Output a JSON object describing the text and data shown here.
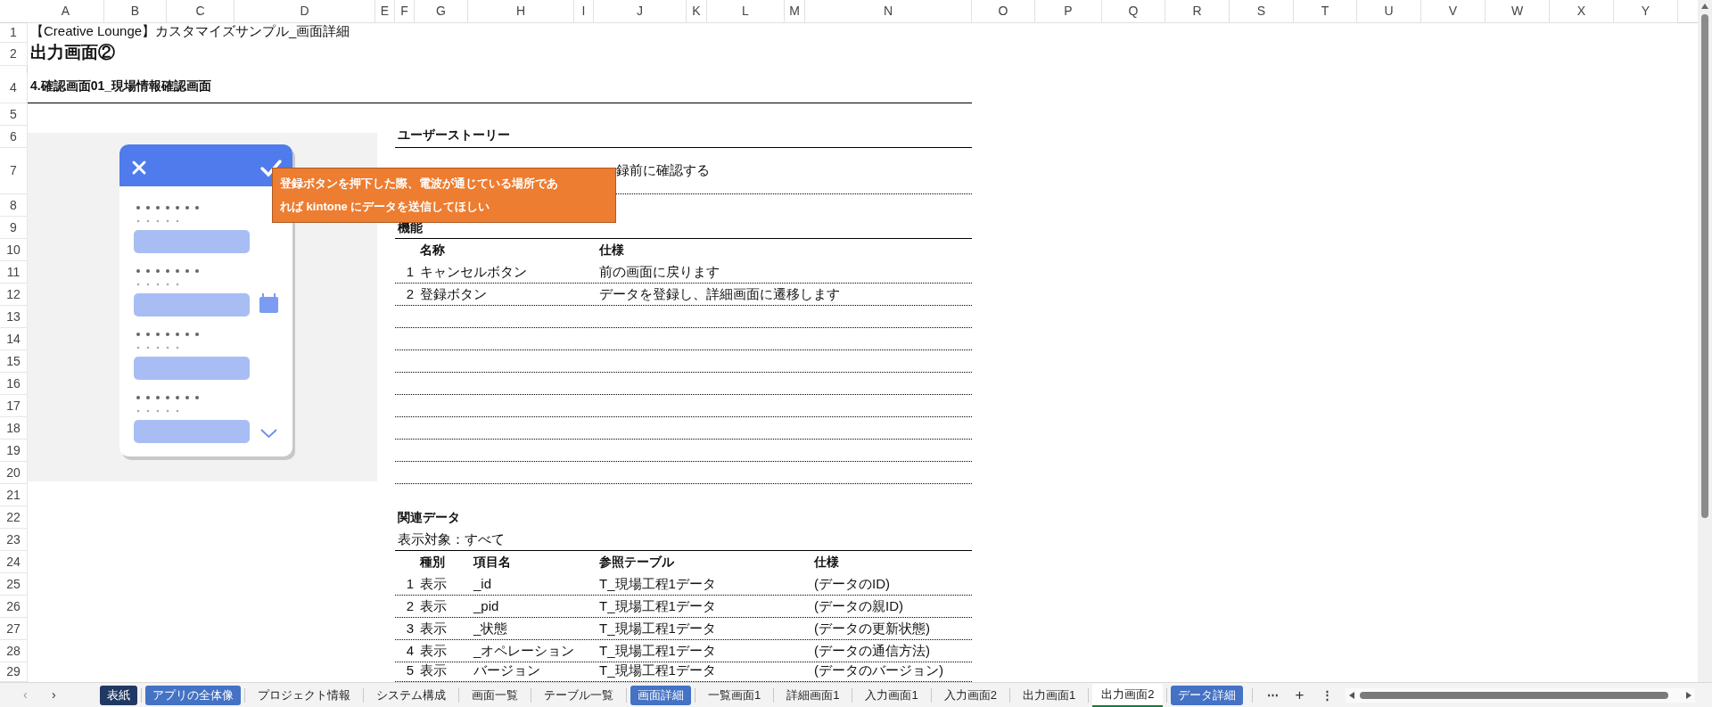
{
  "sheet": {
    "column_headers": [
      "A",
      "B",
      "C",
      "D",
      "E",
      "F",
      "G",
      "H",
      "I",
      "J",
      "K",
      "L",
      "M",
      "N",
      "O",
      "P",
      "Q",
      "R",
      "S",
      "T",
      "U",
      "V",
      "W",
      "X",
      "Y"
    ],
    "row_headers": [
      "1",
      "2",
      "4",
      "5",
      "6",
      "7",
      "8",
      "9",
      "10",
      "11",
      "12",
      "13",
      "14",
      "15",
      "16",
      "17",
      "18",
      "19",
      "20",
      "21",
      "22",
      "23",
      "24",
      "25",
      "26",
      "27",
      "28",
      "29"
    ],
    "title": "【Creative Lounge】カスタマイズサンプル_画面詳細",
    "heading": "出力画面②",
    "section": "4.確認画面01_現場情報確認画面",
    "user_story": {
      "heading": "ユーザーストーリー",
      "text": "録前に確認する"
    },
    "comment": {
      "lines": [
        "登録ボタンを押下した際、電波が通じている場所であ",
        "れば kintone にデータを送信してほしい"
      ]
    },
    "features": {
      "heading": "機能",
      "columns": [
        "名称",
        "仕様"
      ],
      "rows": [
        {
          "no": "1",
          "name": "キャンセルボタン",
          "spec": "前の画面に戻ります"
        },
        {
          "no": "2",
          "name": "登録ボタン",
          "spec": "データを登録し、詳細画面に遷移します"
        }
      ]
    },
    "related": {
      "heading": "関連データ",
      "scope": "表示対象：すべて",
      "columns": [
        "種別",
        "項目名",
        "参照テーブル",
        "仕様"
      ],
      "rows": [
        {
          "no": "1",
          "category": "表示",
          "item": "_id",
          "table": "T_現場工程1データ",
          "spec": "(データのID)"
        },
        {
          "no": "2",
          "category": "表示",
          "item": "_pid",
          "table": "T_現場工程1データ",
          "spec": "(データの親ID)"
        },
        {
          "no": "3",
          "category": "表示",
          "item": "_状態",
          "table": "T_現場工程1データ",
          "spec": "(データの更新状態)"
        },
        {
          "no": "4",
          "category": "表示",
          "item": "_オペレーション",
          "table": "T_現場工程1データ",
          "spec": "(データの通信方法)"
        },
        {
          "no": "5",
          "category": "表示",
          "item": "バージョン",
          "table": "T_現場工程1データ",
          "spec": "(データのバージョン)"
        }
      ]
    }
  },
  "tabs": [
    {
      "label": "表紙",
      "color": "#203864",
      "selected": false
    },
    {
      "label": "アプリの全体像",
      "color": "#4472c4",
      "selected": false
    },
    {
      "label": "プロジェクト情報",
      "selected": false
    },
    {
      "label": "システム構成",
      "selected": false
    },
    {
      "label": "画面一覧",
      "selected": false
    },
    {
      "label": "テーブル一覧",
      "selected": false
    },
    {
      "label": "画面詳細",
      "color": "#4472c4",
      "selected": false
    },
    {
      "label": "一覧画面1",
      "selected": false
    },
    {
      "label": "詳細画面1",
      "selected": false
    },
    {
      "label": "入力画面1",
      "selected": false
    },
    {
      "label": "入力画面2",
      "selected": false
    },
    {
      "label": "出力画面1",
      "selected": false
    },
    {
      "label": "出力画面2",
      "selected": true
    },
    {
      "label": "データ詳細",
      "color": "#4472c4",
      "selected": false
    }
  ],
  "tab_bar": {
    "previous": "‹",
    "next": "›",
    "more": "⋯",
    "add": "+",
    "options": "⋮"
  }
}
